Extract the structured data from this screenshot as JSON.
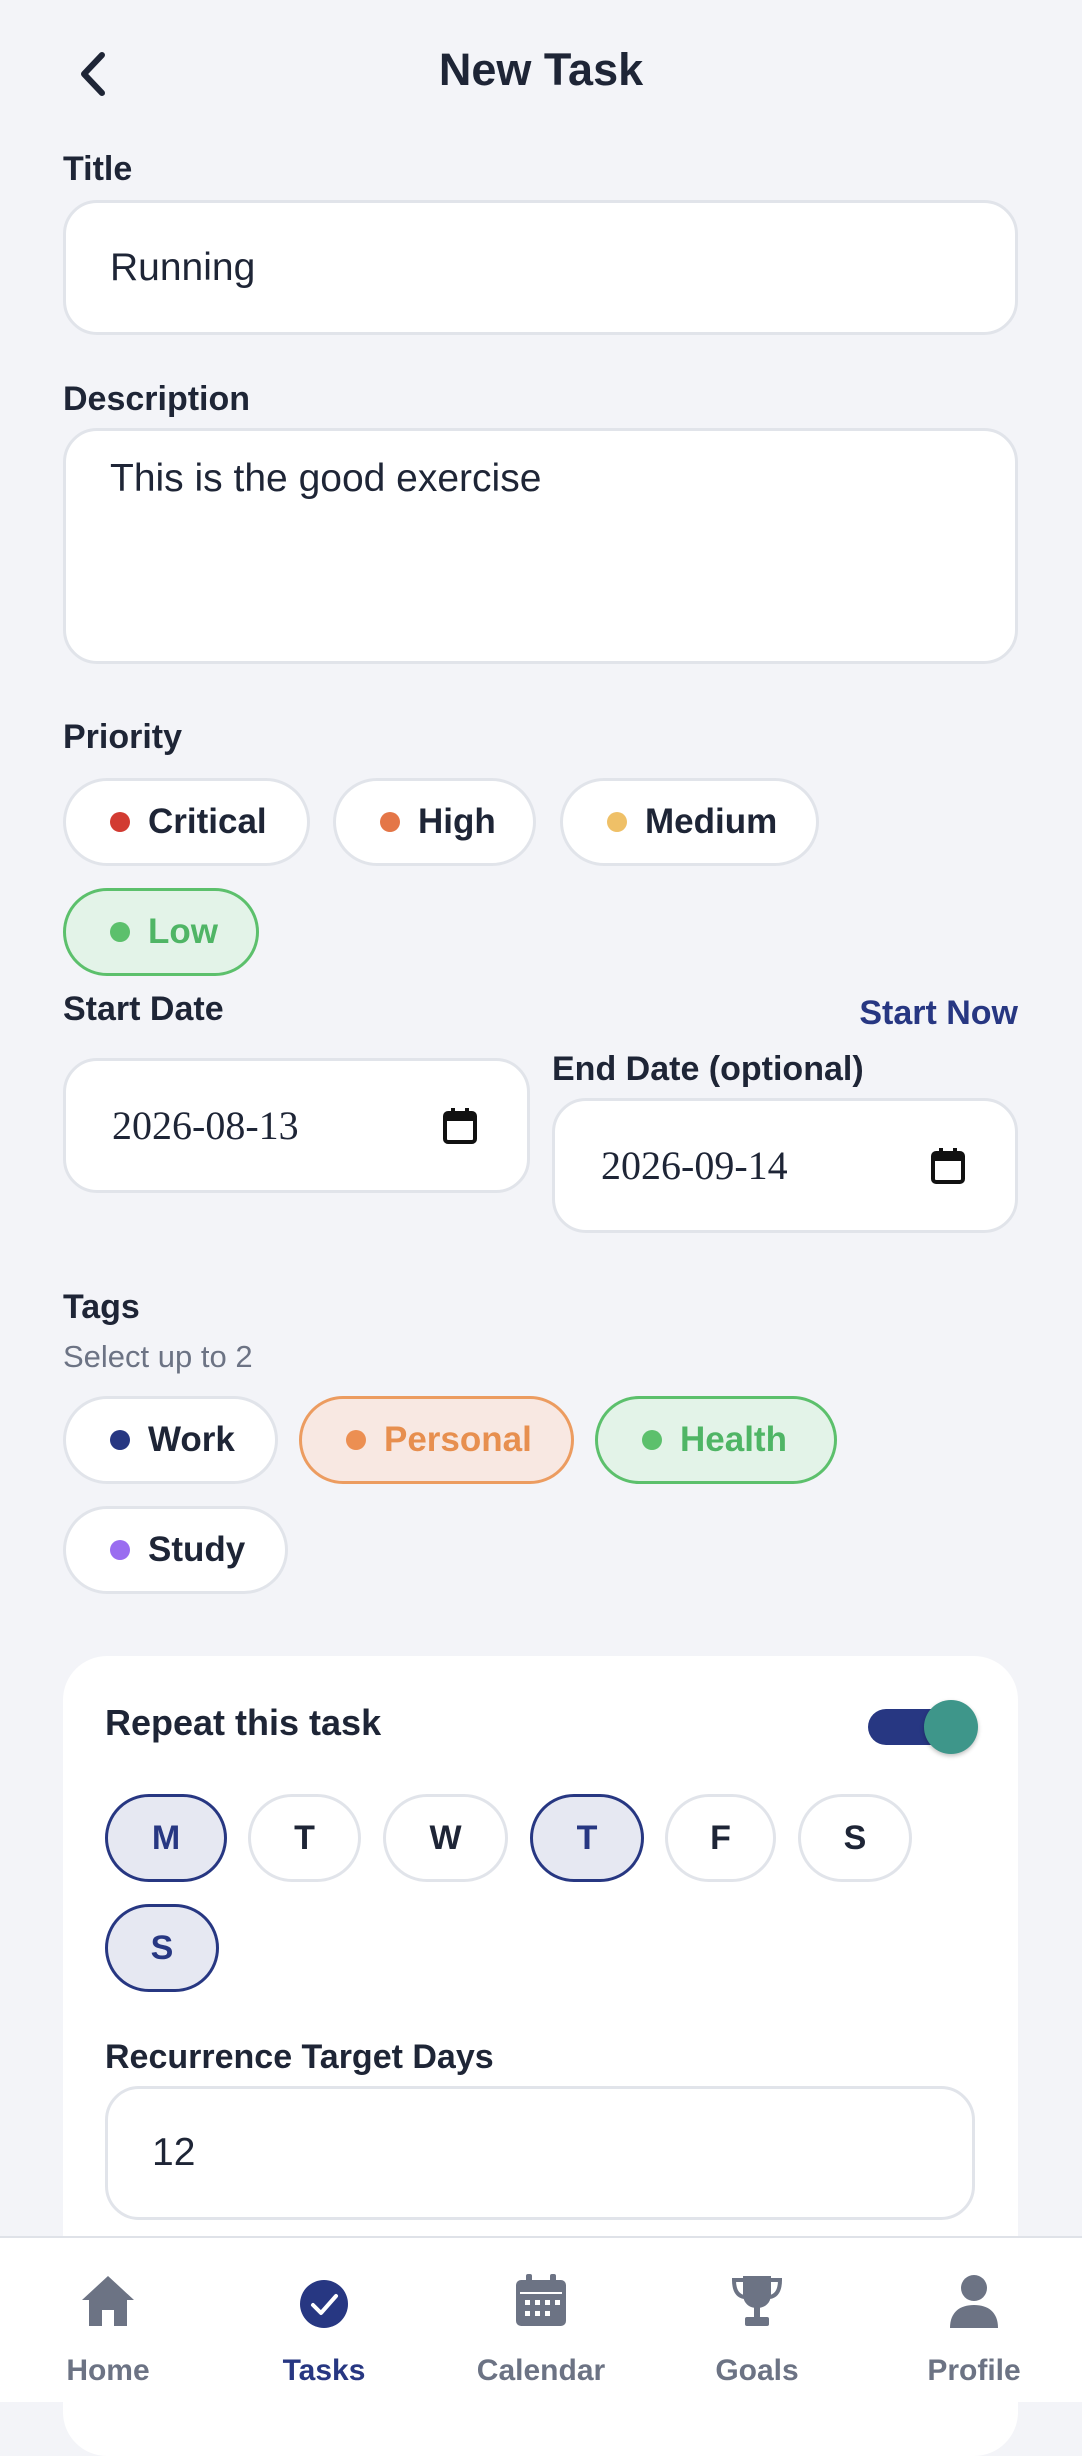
{
  "header": {
    "title": "New Task",
    "back_icon": "chevron-left-icon"
  },
  "form": {
    "title_label": "Title",
    "title_value": "Running",
    "description_label": "Description",
    "description_value": "This is the good exercise",
    "priority_label": "Priority",
    "priorities": [
      {
        "label": "Critical",
        "color": "#d23b32",
        "selected": false
      },
      {
        "label": "High",
        "color": "#e47647",
        "selected": false
      },
      {
        "label": "Medium",
        "color": "#efc067",
        "selected": false
      },
      {
        "label": "Low",
        "color": "#5cc06c",
        "selected": true
      }
    ],
    "start_date_label": "Start Date",
    "start_now_label": "Start Now",
    "start_date_value": "2026-08-13",
    "end_date_label": "End Date (optional)",
    "end_date_value": "2026-09-14",
    "tags_label": "Tags",
    "tags_hint": "Select up to 2",
    "tags": [
      {
        "label": "Work",
        "color": "#273782",
        "selected": false
      },
      {
        "label": "Personal",
        "color": "#ec8f52",
        "selected": true
      },
      {
        "label": "Health",
        "color": "#5cc06c",
        "selected": true
      },
      {
        "label": "Study",
        "color": "#9a6df0",
        "selected": false
      }
    ]
  },
  "repeat": {
    "label": "Repeat this task",
    "enabled": true,
    "days": [
      {
        "label": "M",
        "selected": true
      },
      {
        "label": "T",
        "selected": false
      },
      {
        "label": "W",
        "selected": false
      },
      {
        "label": "T",
        "selected": true
      },
      {
        "label": "F",
        "selected": false
      },
      {
        "label": "S",
        "selected": false
      },
      {
        "label": "S",
        "selected": true
      }
    ],
    "target_label": "Recurrence Target Days",
    "target_value": "12"
  },
  "nav": {
    "items": [
      {
        "label": "Home",
        "icon": "home-icon",
        "active": false
      },
      {
        "label": "Tasks",
        "icon": "check-circle-icon",
        "active": true
      },
      {
        "label": "Calendar",
        "icon": "calendar-icon",
        "active": false
      },
      {
        "label": "Goals",
        "icon": "trophy-icon",
        "active": false
      },
      {
        "label": "Profile",
        "icon": "person-icon",
        "active": false
      }
    ]
  },
  "colors": {
    "accent": "#273782",
    "toggle_knob": "#3e968a",
    "background": "#f3f4f8"
  }
}
